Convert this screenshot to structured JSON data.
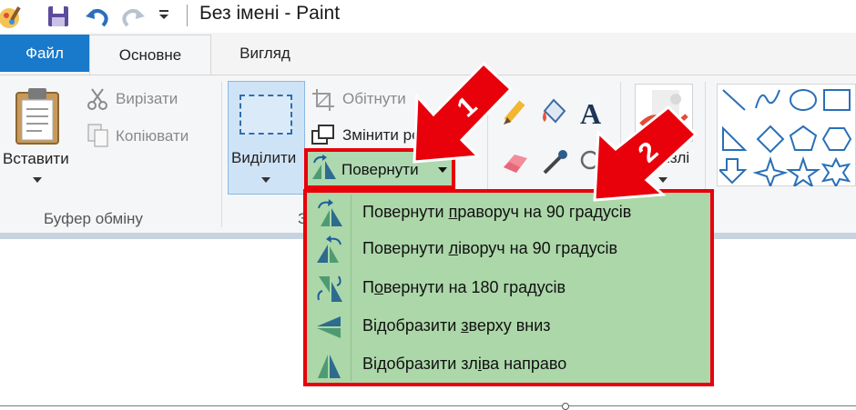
{
  "window": {
    "title": "Без імені - Paint"
  },
  "quick_access": {
    "icons": [
      "paint-app-icon",
      "save-icon",
      "undo-icon",
      "redo-icon",
      "customize-dropdown-icon"
    ]
  },
  "tabs": [
    {
      "label": "Файл",
      "active": false
    },
    {
      "label": "Основне",
      "active": true
    },
    {
      "label": "Вигляд",
      "active": false
    }
  ],
  "clipboard": {
    "paste_label": "Вставити",
    "cut_label": "Вирізати",
    "copy_label": "Копіювати",
    "group_label": "Буфер обміну"
  },
  "image": {
    "select_label": "Виділити",
    "crop_label": "Обітнути",
    "resize_label": "Змінити роз",
    "rotate_label": "Повернути",
    "group_label_fragment": "З"
  },
  "tools": {
    "brushes_label": "ензлі"
  },
  "rotate_menu": {
    "items": [
      {
        "label": "Повернути праворуч на 90 градусів",
        "icon": "rotate-right-90-icon",
        "access_key": "п"
      },
      {
        "label": "Повернути ліворуч на 90 градусів",
        "icon": "rotate-left-90-icon",
        "access_key": "л"
      },
      {
        "label": "Повернути на 180 градусів",
        "icon": "rotate-180-icon",
        "access_key": "о"
      },
      {
        "label": "Відобразити зверху вниз",
        "icon": "flip-vertical-icon",
        "access_key": "з"
      },
      {
        "label": "Відобразити зліва направо",
        "icon": "flip-horizontal-icon",
        "access_key": "і"
      }
    ]
  },
  "annotations": {
    "arrow_1_label": "1",
    "arrow_2_label": "2"
  },
  "colors": {
    "file_tab": "#1979ca",
    "highlight_red": "#e8000b",
    "menu_green": "#acd7a9",
    "select_blue": "#cfe3f7"
  }
}
